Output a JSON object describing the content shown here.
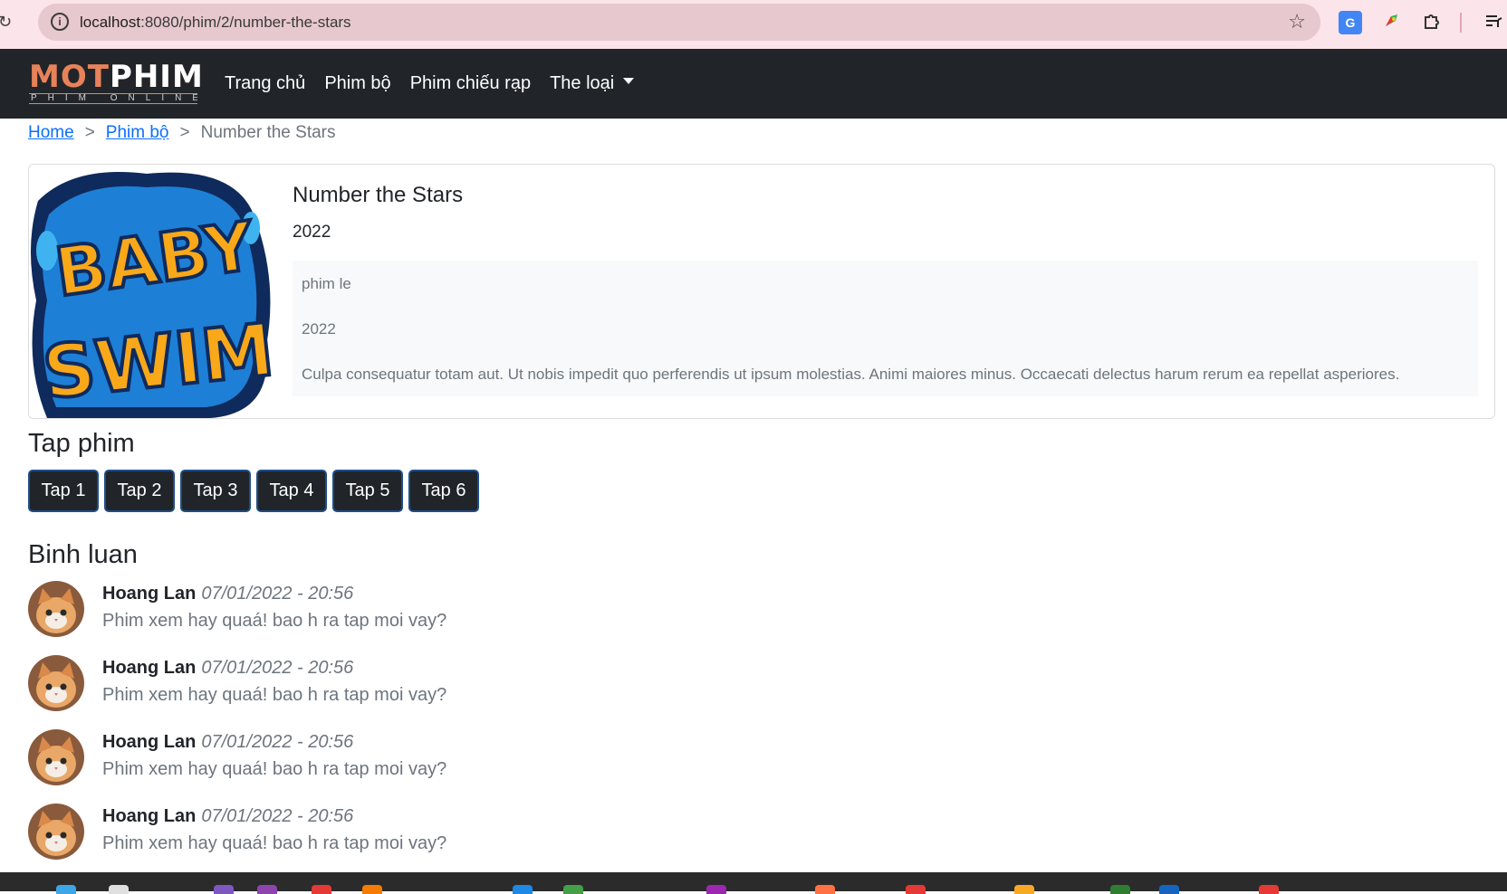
{
  "browser": {
    "url_host": "localhost",
    "url_rest": ":8080/phim/2/number-the-stars"
  },
  "navbar": {
    "brand_main_1": "MOT",
    "brand_main_2": "PHIM",
    "brand_sub": "PHIM ONLINE",
    "links": [
      "Trang chủ",
      "Phim bộ",
      "Phim chiếu rạp",
      "The loại"
    ]
  },
  "breadcrumb": {
    "home": "Home",
    "sep": ">",
    "section": "Phim bộ",
    "current": "Number the Stars"
  },
  "movie": {
    "title": "Number the Stars",
    "year": "2022",
    "poster_text_1": "BABY",
    "poster_text_2": "SWIM",
    "details": {
      "category": "phim le",
      "year": "2022",
      "description": "Culpa consequatur totam aut. Ut nobis impedit quo perferendis ut ipsum molestias. Animi maiores minus. Occaecati delectus harum rerum ea repellat asperiores."
    }
  },
  "episodes": {
    "heading": "Tap phim",
    "items": [
      "Tap 1",
      "Tap 2",
      "Tap 3",
      "Tap 4",
      "Tap 5",
      "Tap 6"
    ]
  },
  "comments": {
    "heading": "Binh luan",
    "items": [
      {
        "name": "Hoang Lan",
        "time": "07/01/2022 - 20:56",
        "text": "Phim xem hay quaá! bao h ra tap moi vay?"
      },
      {
        "name": "Hoang Lan",
        "time": "07/01/2022 - 20:56",
        "text": "Phim xem hay quaá! bao h ra tap moi vay?"
      },
      {
        "name": "Hoang Lan",
        "time": "07/01/2022 - 20:56",
        "text": "Phim xem hay quaá! bao h ra tap moi vay?"
      },
      {
        "name": "Hoang Lan",
        "time": "07/01/2022 - 20:56",
        "text": "Phim xem hay quaá! bao h ra tap moi vay?"
      }
    ]
  },
  "colors": {
    "navbar_bg": "#212529",
    "link": "#0d6efd",
    "brand_accent": "#e8825a",
    "chrome_bg": "#fbe4ea"
  }
}
